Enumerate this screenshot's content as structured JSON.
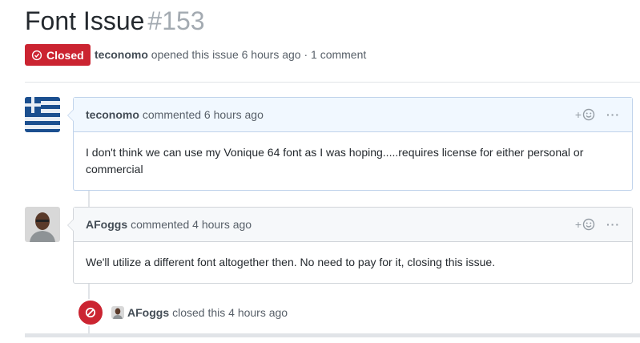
{
  "issue": {
    "title": "Font Issue",
    "number": "#153",
    "state_label": "Closed",
    "author": "teconomo",
    "meta_text": "opened this issue 6 hours ago · 1 comment"
  },
  "comments": [
    {
      "author": "teconomo",
      "action": "commented 6 hours ago",
      "body": "I don't think we can use my Vonique 64 font as I was hoping.....requires license for either personal or commercial",
      "reaction_plus": "+",
      "more": "···"
    },
    {
      "author": "AFoggs",
      "action": "commented 4 hours ago",
      "body": "We'll utilize a different font altogether then. No need to pay for it, closing this issue.",
      "reaction_plus": "+",
      "more": "···"
    }
  ],
  "event": {
    "actor": "AFoggs",
    "text": "closed this 4 hours ago"
  },
  "colors": {
    "closed_red": "#cb2431",
    "highlight_header": "#f1f8ff"
  }
}
